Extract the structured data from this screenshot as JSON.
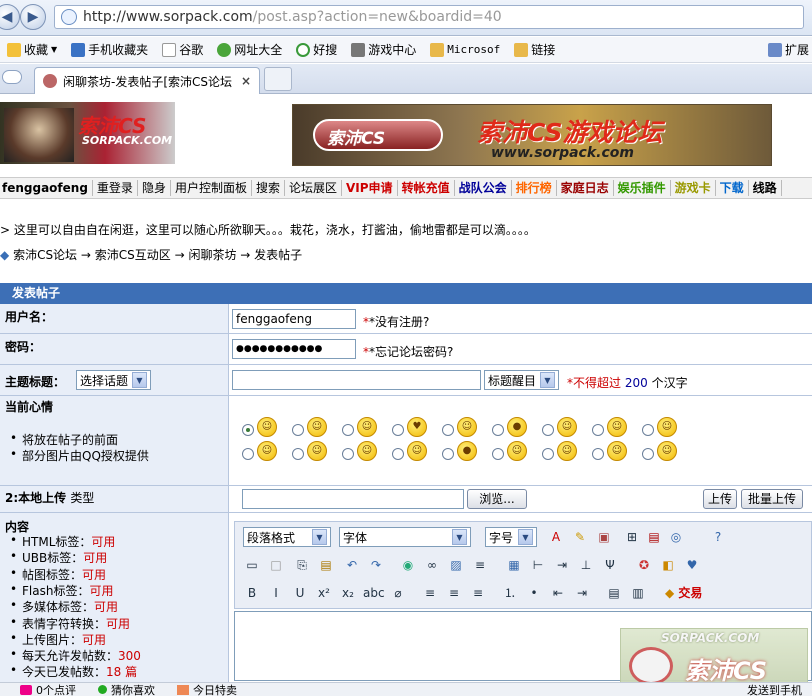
{
  "browser": {
    "url_host": "http://www.sorpack.com",
    "url_path": "/post.asp?action=new&boardid=40"
  },
  "bookmarks": [
    "收藏",
    "手机收藏夹",
    "谷歌",
    "网址大全",
    "好搜",
    "游戏中心",
    "Microsof",
    "链接"
  ],
  "bookmarks_right": "扩展",
  "tab": {
    "title": "闲聊茶坊-发表帖子[索沛CS论坛",
    "close": "×"
  },
  "banner": {
    "logo_text": "索沛CS",
    "logo_sub": "SORPACK.COM",
    "title": "索沛CS游戏论坛",
    "sub": "www.sorpack.com",
    "badge": "索沛CS"
  },
  "menu": [
    "fenggaofeng",
    "重登录",
    "隐身",
    "用户控制面板",
    "搜索",
    "论坛展区",
    "VIP申请",
    "转帐充值",
    "战队公会",
    "排行榜",
    "家庭日志",
    "娱乐插件",
    "游戏卡",
    "下载",
    "线路"
  ],
  "menu_colors": {
    "VIP申请": "#cc0000",
    "转帐充值": "#cc0000",
    "战队公会": "#000099",
    "排行榜": "#ff6600",
    "家庭日志": "#990000",
    "娱乐插件": "#339900",
    "游戏卡": "#999900",
    "下载": "#0066cc"
  },
  "notice": "> 这里可以自由自在闲逛，这里可以随心所欲聊天。。。栽花，浇水，打酱油，偷地雷都是可以滴。。。。",
  "breadcrumb": [
    "索沛CS论坛",
    "索沛CS互动区",
    "闲聊茶坊",
    "发表帖子"
  ],
  "form": {
    "title": "发表帖子",
    "username_label": "用户名：",
    "username_value": "fenggaofeng",
    "username_hint": "*没有注册?",
    "password_label": "密码：",
    "password_value": "●●●●●●●●●●●",
    "password_hint": "*忘记论坛密码?",
    "subject_label": "主题标题：",
    "topic_select": "选择话题",
    "subject_value": "",
    "remind_select": "标题醒目",
    "limit_pre": "*不得超过",
    "limit_num": "200",
    "limit_post": "个汉字",
    "mood_label": "当前心情",
    "mood_notes": [
      "将放在帖子的前面",
      "部分图片由QQ授权提供"
    ],
    "upload_label": "2:本地上传",
    "upload_type": "类型",
    "browse": "浏览...",
    "upload_btn": "上传",
    "batch_btn": "批量上传",
    "content_label": "内容",
    "options": [
      [
        "HTML标签：",
        "可用"
      ],
      [
        "UBB标签：",
        "可用"
      ],
      [
        "帖图标签：",
        "可用"
      ],
      [
        "Flash标签：",
        "可用"
      ],
      [
        "多媒体标签：",
        "可用"
      ],
      [
        "表情字符转换：",
        "可用"
      ],
      [
        "上传图片：",
        "可用"
      ],
      [
        "每天允许发帖数：",
        "300"
      ],
      [
        "今天已发帖数：",
        "18 篇"
      ]
    ],
    "editor": {
      "para": "段落格式",
      "font": "字体",
      "size": "字号",
      "trade": "交易"
    }
  },
  "status": {
    "comments": "0个点评",
    "like": "猜你喜欢",
    "today": "今日特卖",
    "send": "发送到手机"
  },
  "watermark": {
    "site": "SORPACK.COM",
    "name": "索沛CS"
  }
}
